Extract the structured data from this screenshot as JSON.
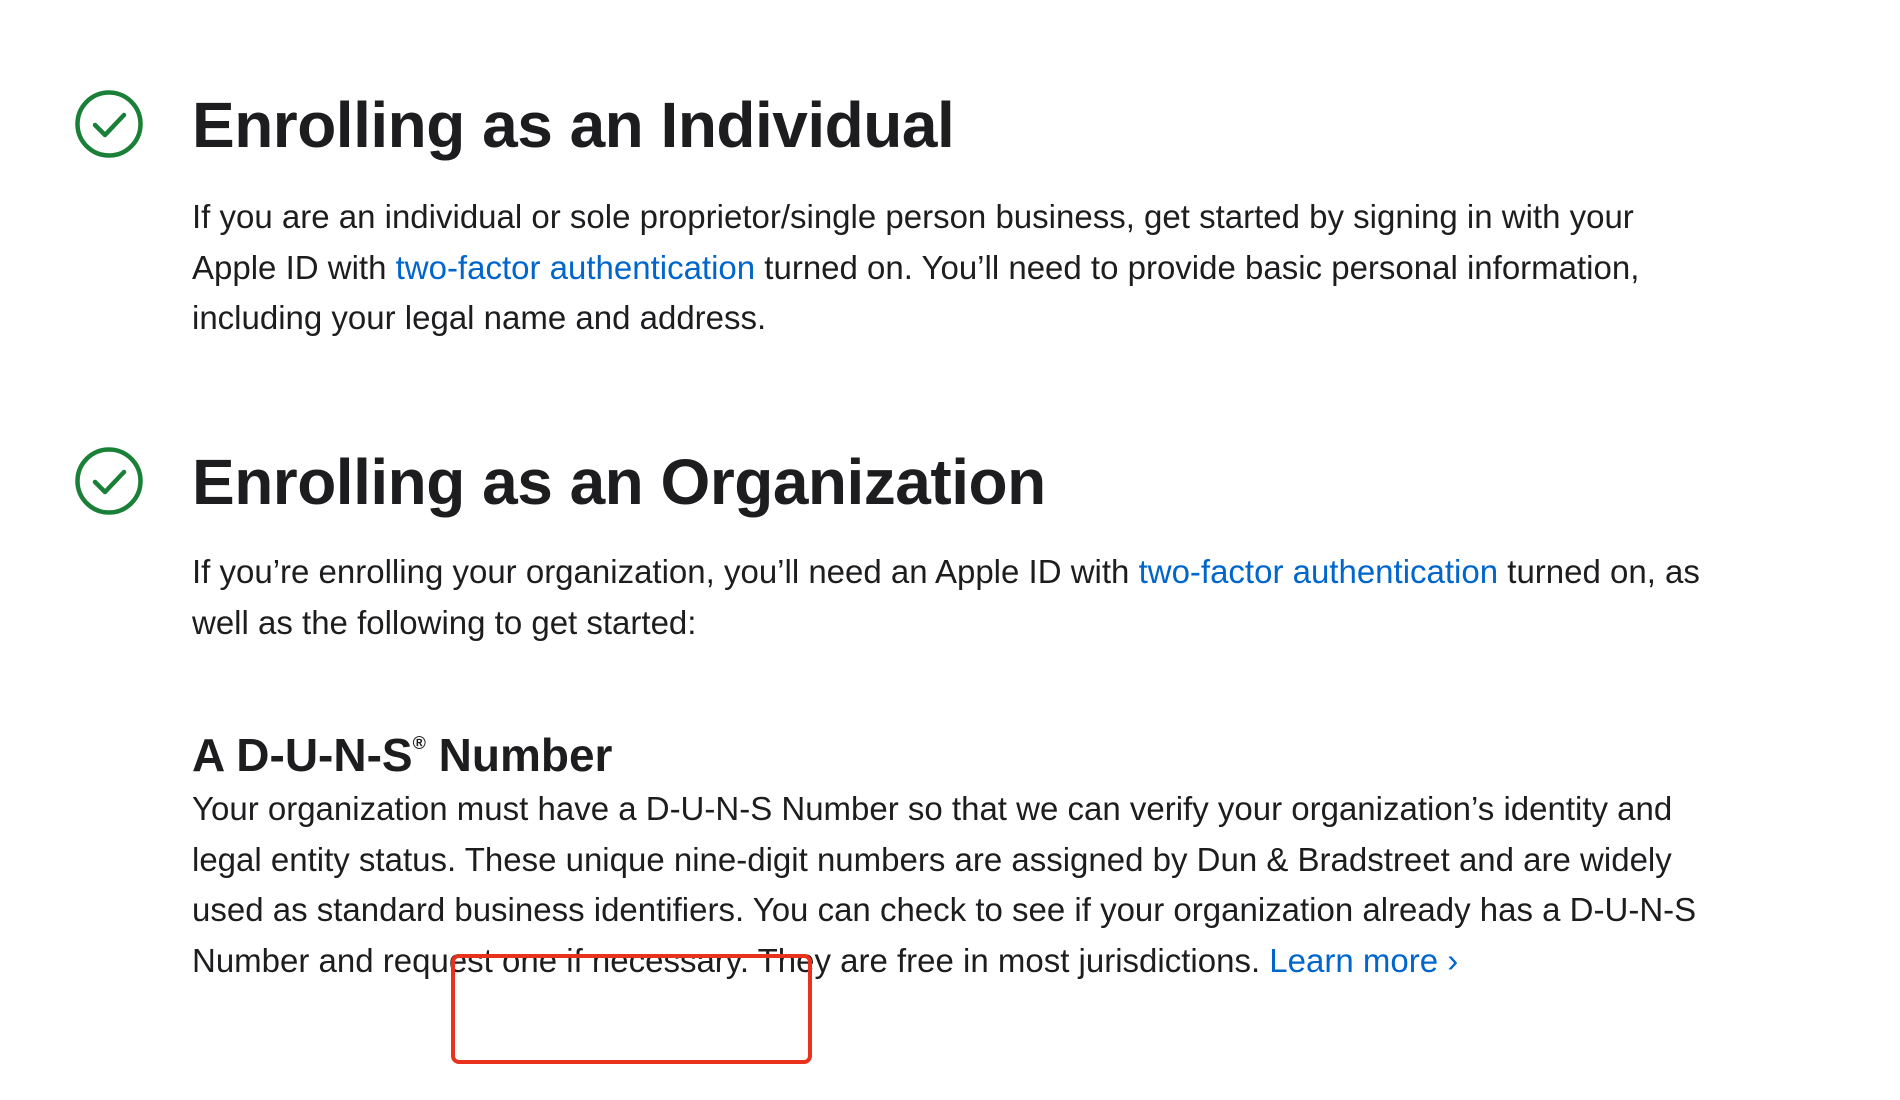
{
  "individual": {
    "title": "Enrolling as an Individual",
    "text_before": "If you are an individual or sole proprietor/single person business, get started by signing in with your Apple ID with ",
    "link": "two-factor authentication",
    "text_after": " turned on. You’ll need to provide basic personal information, including your legal name and address."
  },
  "organization": {
    "title": "Enrolling as an Organization",
    "text_before": "If you’re enrolling your organization, you’ll need an Apple ID with ",
    "link": "two-factor authentication",
    "text_after": " turned on, as well as the following to get started:"
  },
  "duns": {
    "title_main": "A D-U-N-S",
    "title_reg": "®",
    "title_end": " Number",
    "text": "Your organization must have a D-U-N-S Number so that we can verify your organization’s identity and legal entity status. These unique nine-digit numbers are assigned by Dun & Bradstreet and are widely used as standard business identifiers. You can check to see if your organization already has a D-U-N-S Number and request one if necessary. They are free in most jurisdictions. ",
    "learn_more": "Learn more ›"
  },
  "colors": {
    "check_green": "#1a7f37",
    "link_blue": "#0066cc",
    "highlight_red": "#e8321b"
  },
  "icons": {
    "section_check": "check-circle-icon"
  }
}
